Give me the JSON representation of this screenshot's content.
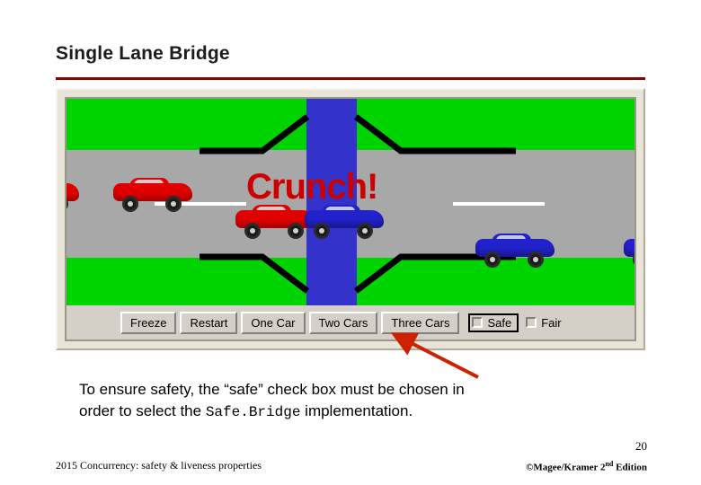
{
  "slide": {
    "title": "Single Lane Bridge",
    "page_number": "20",
    "footer_left": "2015  Concurrency: safety & liveness properties",
    "footer_right_prefix": "©Magee/Kramer ",
    "footer_right_edition_num": "2",
    "footer_right_edition_sup": "nd",
    "footer_right_edition_word": " Edition",
    "title_rule_color": "#8b0000"
  },
  "applet": {
    "crunch_label": "Crunch!",
    "buttons": [
      {
        "label": "Freeze"
      },
      {
        "label": "Restart"
      },
      {
        "label": "One Car"
      },
      {
        "label": "Two Cars"
      },
      {
        "label": "Three Cars"
      }
    ],
    "checkboxes": [
      {
        "label": "Safe",
        "checked": false,
        "highlighted": true
      },
      {
        "label": "Fair",
        "checked": false,
        "highlighted": false
      }
    ],
    "colors": {
      "grass": "#00d400",
      "road": "#a8a8a8",
      "bridge": "#3333cc",
      "red_car": "#e00000",
      "blue_car": "#2222cc",
      "crunch_text": "#cc0000",
      "panel": "#d4d0c8"
    }
  },
  "caption": {
    "line1_pre": "To ensure safety, the “safe” check box must be chosen in",
    "line2_pre": "order to select the ",
    "line2_code": "Safe.Bridge",
    "line2_post": " implementation."
  },
  "arrow": {
    "color": "#cc2200"
  }
}
